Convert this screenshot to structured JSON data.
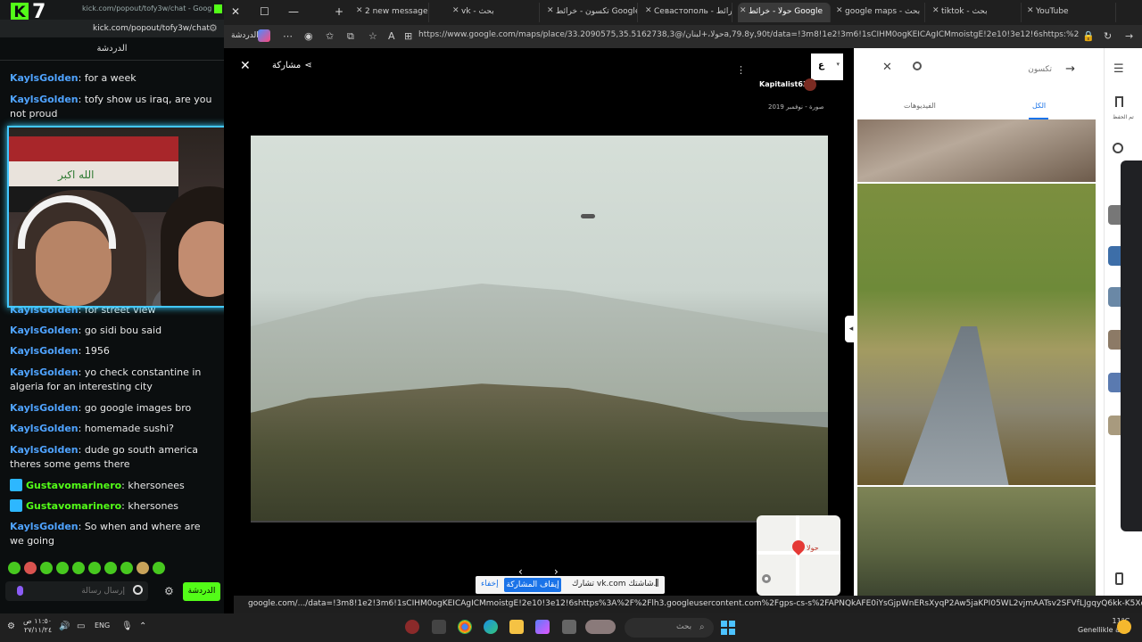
{
  "kick": {
    "logo_letter": "K",
    "logo_num": "7",
    "top_url": "kick.com/popout/tofy3w/chat - Google...",
    "url": "kick.com/popout/tofy3w/chat",
    "chat_title": "الدردشة",
    "messages": [
      {
        "user": "KaylsGolden",
        "text": "for a week"
      },
      {
        "user": "KaylsGolden",
        "text": "tofy show us iraq, are you not proud"
      },
      {
        "user": "KaylsGolden",
        "text": "for street view"
      },
      {
        "user": "KaylsGolden",
        "text": "go sidi bou said"
      },
      {
        "user": "KaylsGolden",
        "text": "1956"
      },
      {
        "user": "KaylsGolden",
        "text": "yo check constantine in algeria for an interesting city"
      },
      {
        "user": "KaylsGolden",
        "text": "go google images bro"
      },
      {
        "user": "KaylsGolden",
        "text": "homemade sushi?"
      },
      {
        "user": "KaylsGolden",
        "text": "dude go south america theres some gems there"
      },
      {
        "user": "Gustavomarinero",
        "text": "khersonees"
      },
      {
        "user": "Gustavomarinero",
        "text": "khersones"
      },
      {
        "user": "KaylsGolden",
        "text": "So when and where are we going"
      }
    ],
    "input_placeholder": "إرسال رسالة",
    "send_label": "الدردشة",
    "flag_text": "الله اكبر",
    "colors": {
      "brand": "#53fc18",
      "username": "#4fa3ff",
      "webcam_border": "#43c8ff"
    }
  },
  "browser": {
    "profile_label": "الدردشة",
    "tabs": [
      {
        "label": "2 new message"
      },
      {
        "label": "vk - بحث"
      },
      {
        "label": "تكسون - خرائط Google"
      },
      {
        "label": "Севастополь - خرائط"
      },
      {
        "label": "حولا - خرائط Google",
        "active": true
      },
      {
        "label": "google maps - بحث"
      },
      {
        "label": "tiktok - بحث"
      },
      {
        "label": "YouTube"
      }
    ],
    "url": "https://www.google.com/maps/place/حولا،+لبنان/@33.2090575,35.5162738,3a,79.8y,90t/data=!3m8!1e2!3m6!1sCIHM0ogKEICAgICMmoistgE!2e10!3e12!6shttps:%2F...",
    "status_url": "google.com/.../data=!3m8!1e2!3m6!1sCIHM0ogKEICAgICMmoistgE!2e10!3e12!6shttps%3A%2F%2Flh3.googleusercontent.com%2Fgps-cs-s%2FAPNQkAFE0iYsGjpWnERsXyqP2Aw5jaKPI05WL2vjmAATsv2SFVfLJgqyQ6kk-K5XcXjp-6cRA4jWgHg2Fri..."
  },
  "viewer": {
    "share_label": "مشاركة",
    "author": "Kapitalist63",
    "date": "صورة - نوفمبر 2019",
    "lang": "ع",
    "minimap_label": "حولا"
  },
  "sharebar": {
    "text": "تشارك vk.com شاشتك.",
    "stop_label": "إيقاف المشاركة",
    "hide_label": "إخفاء"
  },
  "rightpanel": {
    "search_placeholder": "تكسون",
    "tab_all": "الكل",
    "tab_videos": "الفيديوهات",
    "saved_label": "تم الحفظ"
  },
  "taskbar": {
    "time": "١١:٥٠ ص",
    "date": "٢٧/١١/٢٤",
    "lang": "ENG",
    "search_label": "بحث",
    "temp": "11°C",
    "weather": "Genellikle açık"
  }
}
